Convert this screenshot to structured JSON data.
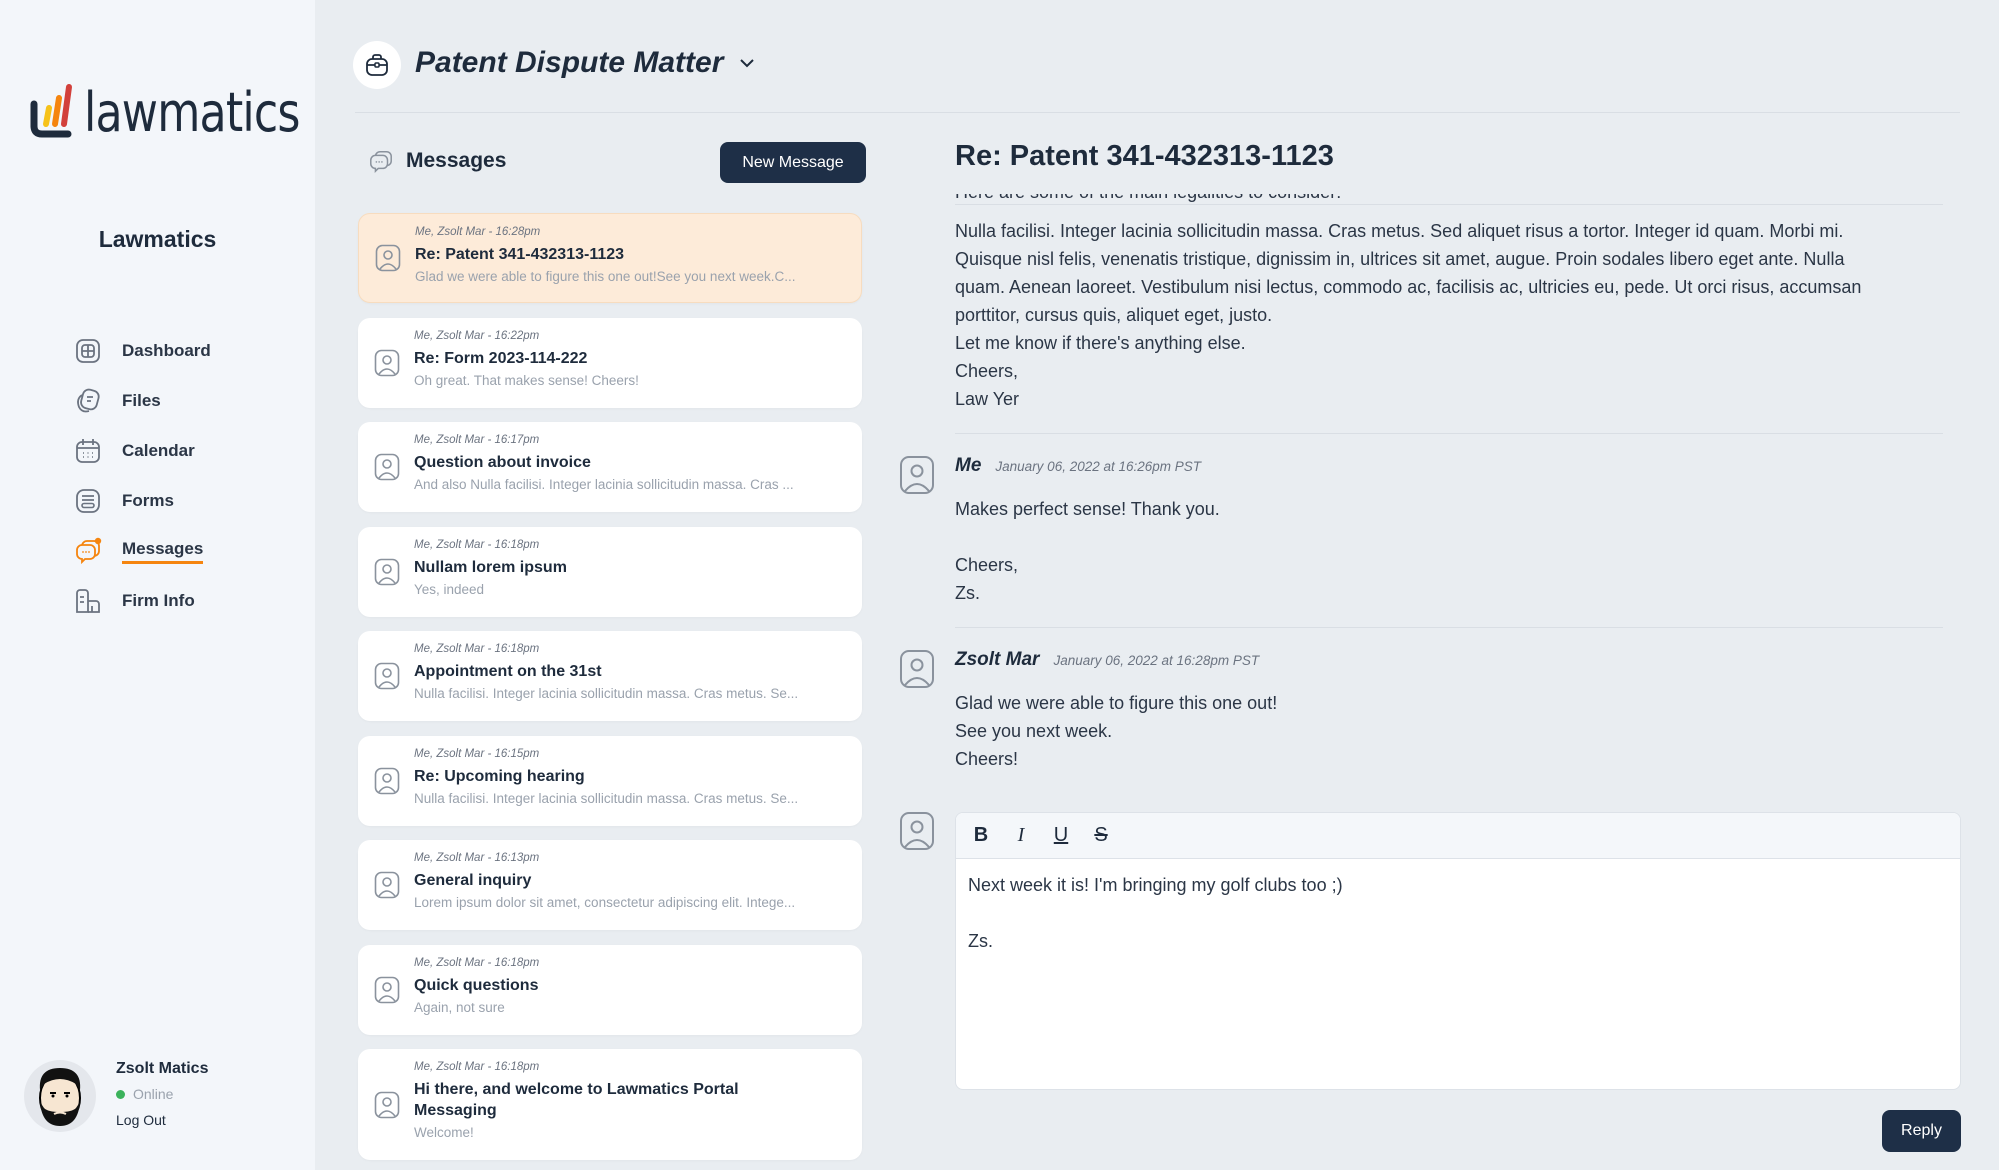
{
  "brand": {
    "logo_text": "lawmatics",
    "firm_name": "Lawmatics",
    "accent": "#f5850f",
    "dark": "#1e2f47"
  },
  "nav": [
    {
      "label": "Dashboard",
      "icon": "dashboard-icon"
    },
    {
      "label": "Files",
      "icon": "files-icon"
    },
    {
      "label": "Calendar",
      "icon": "calendar-icon"
    },
    {
      "label": "Forms",
      "icon": "forms-icon"
    },
    {
      "label": "Messages",
      "icon": "messages-icon",
      "active": true
    },
    {
      "label": "Firm Info",
      "icon": "firm-info-icon"
    }
  ],
  "user": {
    "name": "Zsolt Matics",
    "status": "Online",
    "logout": "Log Out"
  },
  "header": {
    "matter": "Patent Dispute Matter"
  },
  "messages_panel": {
    "title": "Messages",
    "new_button": "New Message"
  },
  "list": [
    {
      "meta": "Me, Zsolt Mar - 16:28pm",
      "subject": "Re: Patent 341-432313-1123",
      "preview": "Glad we were able to figure this one out!See you next week.C...",
      "selected": true
    },
    {
      "meta": "Me, Zsolt Mar - 16:22pm",
      "subject": "Re: Form 2023-114-222",
      "preview": "Oh great. That makes sense! Cheers!"
    },
    {
      "meta": "Me, Zsolt Mar - 16:17pm",
      "subject": "Question about invoice",
      "preview": "And also Nulla facilisi. Integer lacinia sollicitudin massa. Cras ..."
    },
    {
      "meta": "Me, Zsolt Mar - 16:18pm",
      "subject": "Nullam lorem ipsum",
      "preview": "Yes, indeed"
    },
    {
      "meta": "Me, Zsolt Mar - 16:18pm",
      "subject": "Appointment on the 31st",
      "preview": "Nulla facilisi. Integer lacinia sollicitudin massa. Cras metus. Se..."
    },
    {
      "meta": "Me, Zsolt Mar - 16:15pm",
      "subject": "Re: Upcoming hearing",
      "preview": "Nulla facilisi. Integer lacinia sollicitudin massa. Cras metus. Se..."
    },
    {
      "meta": "Me, Zsolt Mar - 16:13pm",
      "subject": "General inquiry",
      "preview": "Lorem ipsum dolor sit amet, consectetur adipiscing elit. Intege..."
    },
    {
      "meta": "Me, Zsolt Mar - 16:18pm",
      "subject": "Quick questions",
      "preview": "Again, not sure"
    },
    {
      "meta": "Me, Zsolt Mar - 16:18pm",
      "subject": "Hi there, and welcome to Lawmatics Portal Messaging",
      "preview": "Welcome!"
    }
  ],
  "thread": {
    "title": "Re: Patent 341-432313-1123",
    "clipped_line": "Here are some of the main legalities to consider:",
    "first_body": [
      "Nulla facilisi. Integer lacinia sollicitudin massa. Cras metus. Sed aliquet risus a tortor. Integer id quam. Morbi mi.",
      "Quisque nisl felis, venenatis tristique, dignissim in, ultrices sit amet, augue. Proin sodales libero eget ante. Nulla",
      "quam. Aenean laoreet. Vestibulum nisi lectus, commodo ac, facilisis ac, ultricies eu, pede. Ut orci risus, accumsan",
      "porttitor, cursus quis, aliquet eget, justo.",
      "Let me know if there's anything else.",
      "Cheers,",
      "Law Yer"
    ],
    "messages": [
      {
        "author": "Me",
        "date": "January 06, 2022 at 16:26pm PST",
        "lines": [
          "Makes perfect sense! Thank you.",
          "",
          "Cheers,",
          "Zs."
        ]
      },
      {
        "author": "Zsolt Mar",
        "date": "January 06, 2022 at 16:28pm PST",
        "lines": [
          "Glad we were able to figure this one out!",
          "See you next week.",
          "Cheers!"
        ]
      }
    ]
  },
  "editor": {
    "toolbar": {
      "bold": "B",
      "italic": "I",
      "underline": "U",
      "strike": "S"
    },
    "lines": [
      "Next week it is! I'm bringing my golf clubs too ;)",
      "",
      "Zs."
    ],
    "reply": "Reply"
  }
}
